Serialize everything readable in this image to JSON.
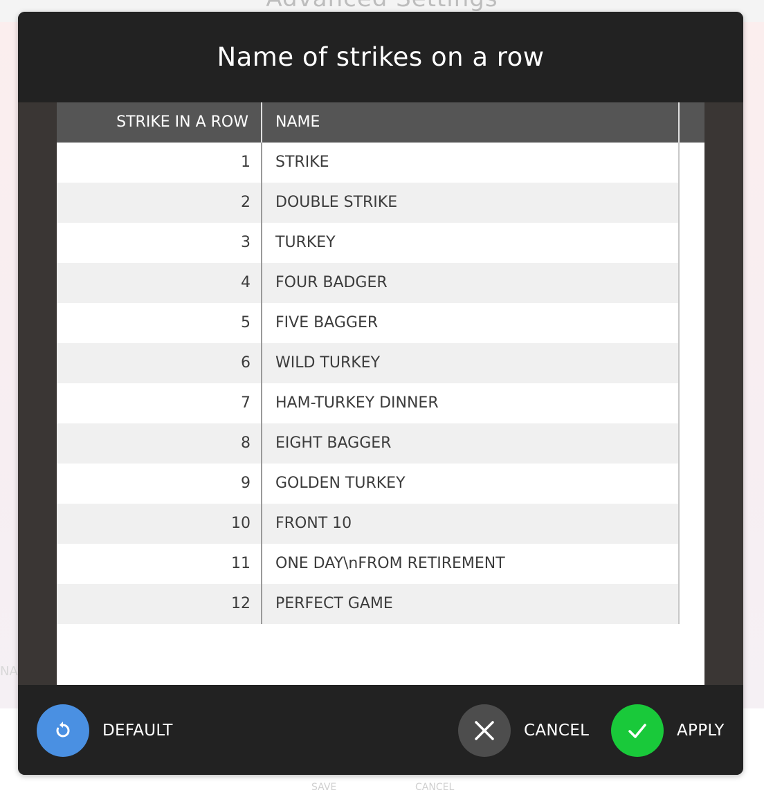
{
  "background": {
    "title": "Advanced Settings",
    "side_label": "NA",
    "footer_buttons": {
      "save": "SAVE",
      "cancel": "CANCEL"
    }
  },
  "dialog": {
    "title": "Name of strikes on a row",
    "table": {
      "columns": [
        "STRIKE IN A ROW",
        "NAME"
      ],
      "rows": [
        {
          "strike": "1",
          "name": "STRIKE"
        },
        {
          "strike": "2",
          "name": "DOUBLE STRIKE"
        },
        {
          "strike": "3",
          "name": "TURKEY"
        },
        {
          "strike": "4",
          "name": "FOUR BADGER"
        },
        {
          "strike": "5",
          "name": "FIVE BAGGER"
        },
        {
          "strike": "6",
          "name": "WILD TURKEY"
        },
        {
          "strike": "7",
          "name": "HAM-TURKEY DINNER"
        },
        {
          "strike": "8",
          "name": "EIGHT BAGGER"
        },
        {
          "strike": "9",
          "name": "GOLDEN TURKEY"
        },
        {
          "strike": "10",
          "name": "FRONT 10"
        },
        {
          "strike": "11",
          "name": "ONE DAY\\nFROM RETIREMENT"
        },
        {
          "strike": "12",
          "name": "PERFECT GAME"
        }
      ]
    },
    "footer": {
      "default_label": "DEFAULT",
      "default_icon": "reset-icon",
      "cancel_label": "CANCEL",
      "cancel_icon": "close-icon",
      "apply_label": "APPLY",
      "apply_icon": "check-icon"
    }
  },
  "colors": {
    "default_button": "#4a90e2",
    "cancel_button": "#4d4d4d",
    "apply_button": "#19c93a",
    "dialog_bg": "#222222",
    "table_header_bg": "#555555"
  }
}
